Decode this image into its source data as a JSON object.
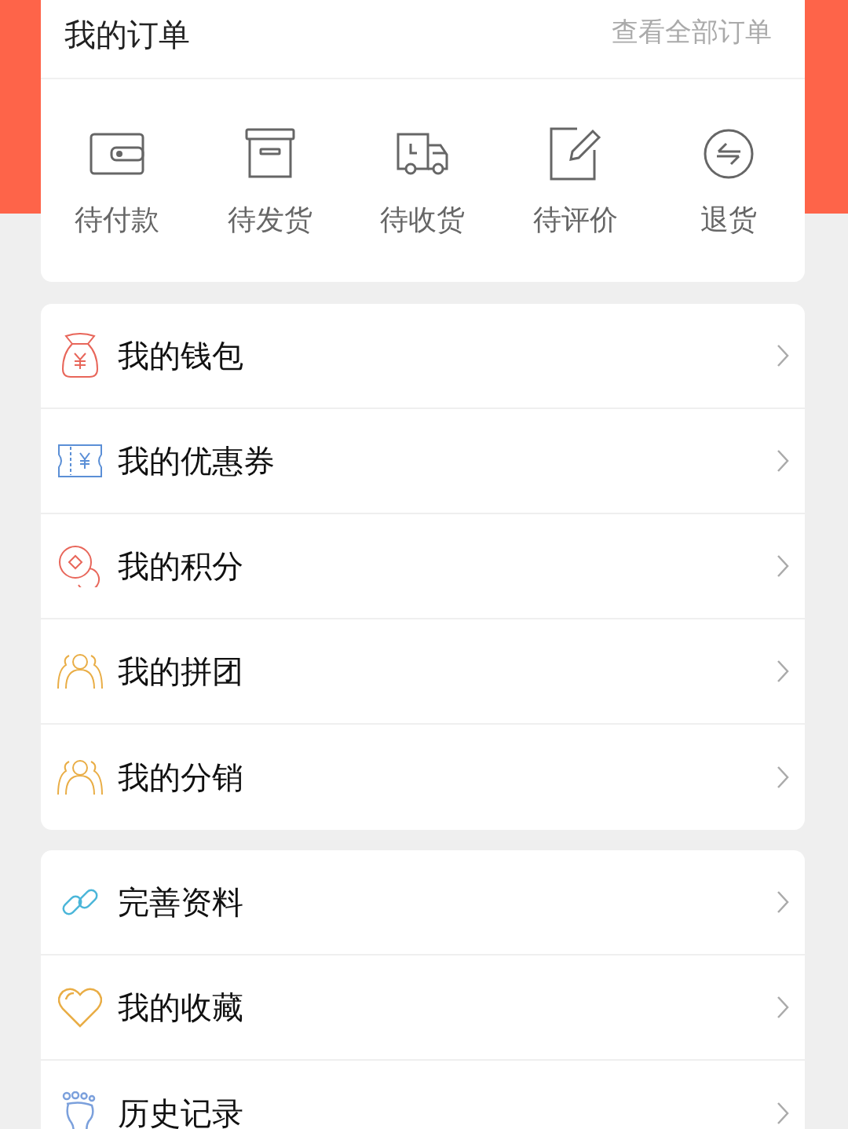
{
  "orders": {
    "title": "我的订单",
    "view_all": "查看全部订单",
    "statuses": [
      {
        "label": "待付款"
      },
      {
        "label": "待发货"
      },
      {
        "label": "待收货"
      },
      {
        "label": "待评价"
      },
      {
        "label": "退货"
      }
    ]
  },
  "menu_groups": [
    {
      "items": [
        {
          "label": "我的钱包"
        },
        {
          "label": "我的优惠券"
        },
        {
          "label": "我的积分"
        },
        {
          "label": "我的拼团"
        },
        {
          "label": "我的分销"
        }
      ]
    },
    {
      "items": [
        {
          "label": "完善资料"
        },
        {
          "label": "我的收藏"
        },
        {
          "label": "历史记录"
        }
      ]
    }
  ]
}
